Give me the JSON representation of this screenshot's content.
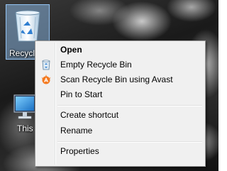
{
  "desktop": {
    "icons": [
      {
        "label": "Recycle Bin",
        "icon": "recycle-bin-icon"
      },
      {
        "label": "This PC",
        "icon": "computer-icon"
      }
    ]
  },
  "context_menu": {
    "items": [
      {
        "label": "Open",
        "bold": true
      },
      {
        "label": "Empty Recycle Bin",
        "icon": "recycle-bin-empty-icon"
      },
      {
        "label": "Scan Recycle Bin using Avast",
        "icon": "avast-icon"
      },
      {
        "label": "Pin to Start"
      },
      {
        "label": "Create shortcut"
      },
      {
        "label": "Rename"
      },
      {
        "label": "Properties"
      }
    ]
  },
  "colors": {
    "selection": "#99ccff",
    "menu_bg": "#f0f0f0",
    "menu_border": "#979797",
    "avast_orange": "#f47a20"
  }
}
